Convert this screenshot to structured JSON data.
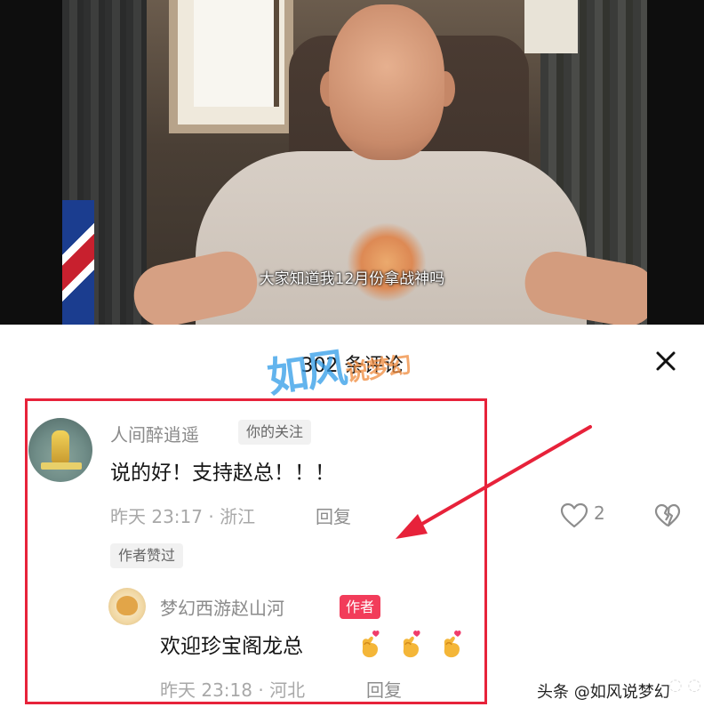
{
  "video": {
    "subtitle": "大家知道我12月份拿战神吗"
  },
  "comments_panel": {
    "title": "302 条评论",
    "close_icon": "close-icon",
    "watermark_logo": "如风说梦幻"
  },
  "comment": {
    "username": "人间醉逍遥",
    "follow_tag": "你的关注",
    "text": "说的好！支持赵总！！！",
    "time_location": "昨天 23:17 · 浙江",
    "reply_label": "回复",
    "like_count": "2",
    "author_liked_tag": "作者赞过"
  },
  "reply": {
    "username": "梦幻西游赵山河",
    "author_tag": "作者",
    "text": "欢迎珍宝阁龙总",
    "emoji_icon": "heart-hand-emoji",
    "emoji_count": 3,
    "time_location": "昨天 23:18 · 河北",
    "reply_label": "回复"
  },
  "annotation": {
    "highlight_color": "#e7223a",
    "arrow_color": "#e7223a"
  },
  "source_watermark": "头条 @如风说梦幻"
}
